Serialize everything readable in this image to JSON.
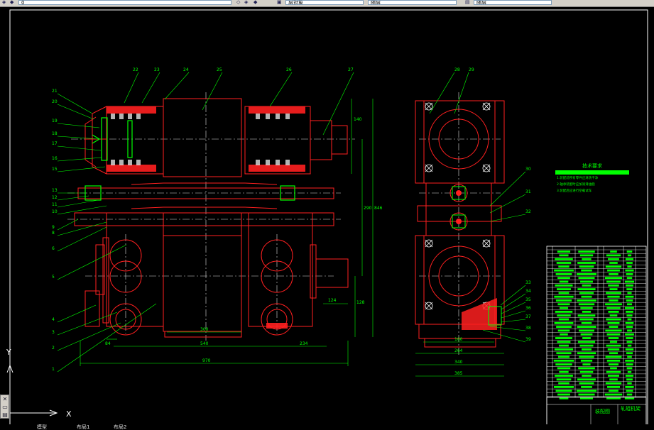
{
  "toolbar": {
    "layer_field": "0",
    "linetype_field": "层对象",
    "color_field": "随层",
    "lineweight_field": "随层",
    "icons": [
      "layer-icon",
      "layer-state-icon",
      "match-icon",
      "properties-icon",
      "print-icon"
    ]
  },
  "drawing": {
    "front_labels": [
      "22",
      "23",
      "24",
      "25",
      "26",
      "27",
      "21",
      "20",
      "19",
      "18",
      "17",
      "16",
      "15",
      "13",
      "12",
      "11",
      "10",
      "9",
      "8",
      "6",
      "5",
      "4",
      "3",
      "2",
      "1"
    ],
    "side_labels": [
      "28",
      "29",
      "30",
      "31",
      "32",
      "33",
      "34",
      "35",
      "36",
      "37",
      "38",
      "39"
    ],
    "dimensions": {
      "d140": "140",
      "d290": "290",
      "d846": "846",
      "d128": "128",
      "d124": "124",
      "d300": "300",
      "d540": "540",
      "d84": "84",
      "d234": "234",
      "d970": "970",
      "d160": "160",
      "d264": "264",
      "d340": "340",
      "d385": "385"
    },
    "tech_title": "技术要求",
    "tech_lines": [
      "1.装配前所有零件应清洗干净",
      "2.轴承装配时应加润滑油脂",
      "3.装配后应进行空载试车"
    ],
    "title_block_name": "装配图",
    "title_block_product": "轧辊机架"
  },
  "ucs": {
    "x_label": "X",
    "y_label": "Y"
  },
  "tabs": [
    "模型",
    "布局1",
    "布局2"
  ],
  "colors": {
    "green": "#00ff00",
    "red": "#ff2020",
    "white": "#ffffff",
    "bg": "#000000"
  }
}
